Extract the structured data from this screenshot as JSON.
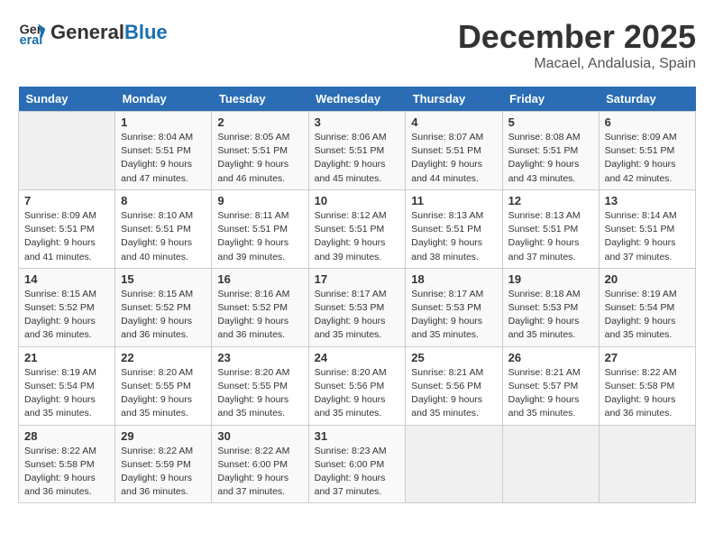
{
  "header": {
    "logo_line1": "General",
    "logo_line2": "Blue",
    "month": "December 2025",
    "location": "Macael, Andalusia, Spain"
  },
  "weekdays": [
    "Sunday",
    "Monday",
    "Tuesday",
    "Wednesday",
    "Thursday",
    "Friday",
    "Saturday"
  ],
  "weeks": [
    [
      {
        "day": "",
        "sunrise": "",
        "sunset": "",
        "daylight": ""
      },
      {
        "day": "1",
        "sunrise": "Sunrise: 8:04 AM",
        "sunset": "Sunset: 5:51 PM",
        "daylight": "Daylight: 9 hours and 47 minutes."
      },
      {
        "day": "2",
        "sunrise": "Sunrise: 8:05 AM",
        "sunset": "Sunset: 5:51 PM",
        "daylight": "Daylight: 9 hours and 46 minutes."
      },
      {
        "day": "3",
        "sunrise": "Sunrise: 8:06 AM",
        "sunset": "Sunset: 5:51 PM",
        "daylight": "Daylight: 9 hours and 45 minutes."
      },
      {
        "day": "4",
        "sunrise": "Sunrise: 8:07 AM",
        "sunset": "Sunset: 5:51 PM",
        "daylight": "Daylight: 9 hours and 44 minutes."
      },
      {
        "day": "5",
        "sunrise": "Sunrise: 8:08 AM",
        "sunset": "Sunset: 5:51 PM",
        "daylight": "Daylight: 9 hours and 43 minutes."
      },
      {
        "day": "6",
        "sunrise": "Sunrise: 8:09 AM",
        "sunset": "Sunset: 5:51 PM",
        "daylight": "Daylight: 9 hours and 42 minutes."
      }
    ],
    [
      {
        "day": "7",
        "sunrise": "Sunrise: 8:09 AM",
        "sunset": "Sunset: 5:51 PM",
        "daylight": "Daylight: 9 hours and 41 minutes."
      },
      {
        "day": "8",
        "sunrise": "Sunrise: 8:10 AM",
        "sunset": "Sunset: 5:51 PM",
        "daylight": "Daylight: 9 hours and 40 minutes."
      },
      {
        "day": "9",
        "sunrise": "Sunrise: 8:11 AM",
        "sunset": "Sunset: 5:51 PM",
        "daylight": "Daylight: 9 hours and 39 minutes."
      },
      {
        "day": "10",
        "sunrise": "Sunrise: 8:12 AM",
        "sunset": "Sunset: 5:51 PM",
        "daylight": "Daylight: 9 hours and 39 minutes."
      },
      {
        "day": "11",
        "sunrise": "Sunrise: 8:13 AM",
        "sunset": "Sunset: 5:51 PM",
        "daylight": "Daylight: 9 hours and 38 minutes."
      },
      {
        "day": "12",
        "sunrise": "Sunrise: 8:13 AM",
        "sunset": "Sunset: 5:51 PM",
        "daylight": "Daylight: 9 hours and 37 minutes."
      },
      {
        "day": "13",
        "sunrise": "Sunrise: 8:14 AM",
        "sunset": "Sunset: 5:51 PM",
        "daylight": "Daylight: 9 hours and 37 minutes."
      }
    ],
    [
      {
        "day": "14",
        "sunrise": "Sunrise: 8:15 AM",
        "sunset": "Sunset: 5:52 PM",
        "daylight": "Daylight: 9 hours and 36 minutes."
      },
      {
        "day": "15",
        "sunrise": "Sunrise: 8:15 AM",
        "sunset": "Sunset: 5:52 PM",
        "daylight": "Daylight: 9 hours and 36 minutes."
      },
      {
        "day": "16",
        "sunrise": "Sunrise: 8:16 AM",
        "sunset": "Sunset: 5:52 PM",
        "daylight": "Daylight: 9 hours and 36 minutes."
      },
      {
        "day": "17",
        "sunrise": "Sunrise: 8:17 AM",
        "sunset": "Sunset: 5:53 PM",
        "daylight": "Daylight: 9 hours and 35 minutes."
      },
      {
        "day": "18",
        "sunrise": "Sunrise: 8:17 AM",
        "sunset": "Sunset: 5:53 PM",
        "daylight": "Daylight: 9 hours and 35 minutes."
      },
      {
        "day": "19",
        "sunrise": "Sunrise: 8:18 AM",
        "sunset": "Sunset: 5:53 PM",
        "daylight": "Daylight: 9 hours and 35 minutes."
      },
      {
        "day": "20",
        "sunrise": "Sunrise: 8:19 AM",
        "sunset": "Sunset: 5:54 PM",
        "daylight": "Daylight: 9 hours and 35 minutes."
      }
    ],
    [
      {
        "day": "21",
        "sunrise": "Sunrise: 8:19 AM",
        "sunset": "Sunset: 5:54 PM",
        "daylight": "Daylight: 9 hours and 35 minutes."
      },
      {
        "day": "22",
        "sunrise": "Sunrise: 8:20 AM",
        "sunset": "Sunset: 5:55 PM",
        "daylight": "Daylight: 9 hours and 35 minutes."
      },
      {
        "day": "23",
        "sunrise": "Sunrise: 8:20 AM",
        "sunset": "Sunset: 5:55 PM",
        "daylight": "Daylight: 9 hours and 35 minutes."
      },
      {
        "day": "24",
        "sunrise": "Sunrise: 8:20 AM",
        "sunset": "Sunset: 5:56 PM",
        "daylight": "Daylight: 9 hours and 35 minutes."
      },
      {
        "day": "25",
        "sunrise": "Sunrise: 8:21 AM",
        "sunset": "Sunset: 5:56 PM",
        "daylight": "Daylight: 9 hours and 35 minutes."
      },
      {
        "day": "26",
        "sunrise": "Sunrise: 8:21 AM",
        "sunset": "Sunset: 5:57 PM",
        "daylight": "Daylight: 9 hours and 35 minutes."
      },
      {
        "day": "27",
        "sunrise": "Sunrise: 8:22 AM",
        "sunset": "Sunset: 5:58 PM",
        "daylight": "Daylight: 9 hours and 36 minutes."
      }
    ],
    [
      {
        "day": "28",
        "sunrise": "Sunrise: 8:22 AM",
        "sunset": "Sunset: 5:58 PM",
        "daylight": "Daylight: 9 hours and 36 minutes."
      },
      {
        "day": "29",
        "sunrise": "Sunrise: 8:22 AM",
        "sunset": "Sunset: 5:59 PM",
        "daylight": "Daylight: 9 hours and 36 minutes."
      },
      {
        "day": "30",
        "sunrise": "Sunrise: 8:22 AM",
        "sunset": "Sunset: 6:00 PM",
        "daylight": "Daylight: 9 hours and 37 minutes."
      },
      {
        "day": "31",
        "sunrise": "Sunrise: 8:23 AM",
        "sunset": "Sunset: 6:00 PM",
        "daylight": "Daylight: 9 hours and 37 minutes."
      },
      {
        "day": "",
        "sunrise": "",
        "sunset": "",
        "daylight": ""
      },
      {
        "day": "",
        "sunrise": "",
        "sunset": "",
        "daylight": ""
      },
      {
        "day": "",
        "sunrise": "",
        "sunset": "",
        "daylight": ""
      }
    ]
  ]
}
